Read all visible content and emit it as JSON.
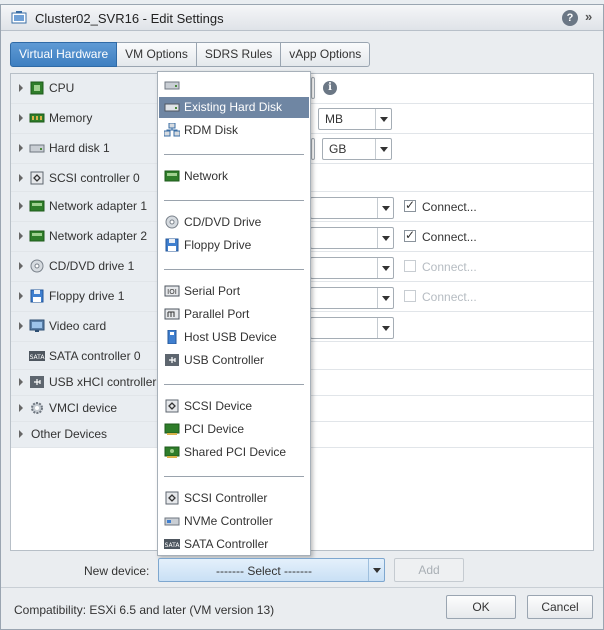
{
  "dialog": {
    "title": "Cluster02_SVR16 - Edit Settings",
    "help_glyph": "?",
    "expand_glyph": "»"
  },
  "tabs": [
    {
      "label": "Virtual Hardware",
      "active": true
    },
    {
      "label": "VM Options",
      "active": false
    },
    {
      "label": "SDRS Rules",
      "active": false
    },
    {
      "label": "vApp Options",
      "active": false
    }
  ],
  "hardware": [
    {
      "label": "CPU",
      "icon": "cpu-icon"
    },
    {
      "label": "Memory",
      "icon": "memory-icon"
    },
    {
      "label": "Hard disk 1",
      "icon": "hard-disk-icon"
    },
    {
      "label": "SCSI controller 0",
      "icon": "scsi-controller-icon"
    },
    {
      "label": "Network adapter 1",
      "icon": "network-adapter-icon"
    },
    {
      "label": "Network adapter 2",
      "icon": "network-adapter-icon"
    },
    {
      "label": "CD/DVD drive 1",
      "icon": "cd-dvd-icon"
    },
    {
      "label": "Floppy drive 1",
      "icon": "floppy-icon"
    },
    {
      "label": "Video card",
      "icon": "video-card-icon"
    },
    {
      "label": "SATA controller 0",
      "icon": "sata-icon"
    },
    {
      "label": "USB xHCI controller",
      "icon": "usb-icon"
    },
    {
      "label": "VMCI device",
      "icon": "vmci-gear-icon"
    },
    {
      "label": "Other Devices",
      "icon": ""
    }
  ],
  "fields": {
    "memory_unit": "MB",
    "disk_unit": "GB",
    "info_glyph": "i",
    "connect_label": "Connect..."
  },
  "device_menu": {
    "items": [
      {
        "label": "",
        "icon": "hard-disk-icon"
      },
      {
        "label": "Existing Hard Disk",
        "icon": "hard-disk-icon",
        "selected": true
      },
      {
        "label": "RDM Disk",
        "icon": "rdm-disk-icon"
      },
      {
        "label": "Network",
        "icon": "network-adapter-icon"
      },
      {
        "label": "CD/DVD Drive",
        "icon": "cd-dvd-icon"
      },
      {
        "label": "Floppy Drive",
        "icon": "floppy-icon"
      },
      {
        "label": "Serial Port",
        "icon": "serial-port-icon"
      },
      {
        "label": "Parallel Port",
        "icon": "parallel-port-icon"
      },
      {
        "label": "Host USB Device",
        "icon": "host-usb-icon"
      },
      {
        "label": "USB Controller",
        "icon": "usb-icon"
      },
      {
        "label": "SCSI Device",
        "icon": "scsi-device-icon"
      },
      {
        "label": "PCI Device",
        "icon": "pci-device-icon"
      },
      {
        "label": "Shared PCI Device",
        "icon": "shared-pci-icon"
      },
      {
        "label": "SCSI Controller",
        "icon": "scsi-controller-icon"
      },
      {
        "label": "NVMe Controller",
        "icon": "nvme-icon"
      },
      {
        "label": "SATA Controller",
        "icon": "sata-icon"
      }
    ]
  },
  "new_device": {
    "label": "New device:",
    "select_value": "------- Select -------",
    "add_label": "Add"
  },
  "footer": {
    "compatibility": "Compatibility: ESXi 6.5 and later (VM version 13)",
    "ok_label": "OK",
    "cancel_label": "Cancel"
  },
  "colors": {
    "active_tab": "#4a8ac8",
    "menu_selected": "#6f86a3",
    "chip_green": "#3b8a2e"
  }
}
